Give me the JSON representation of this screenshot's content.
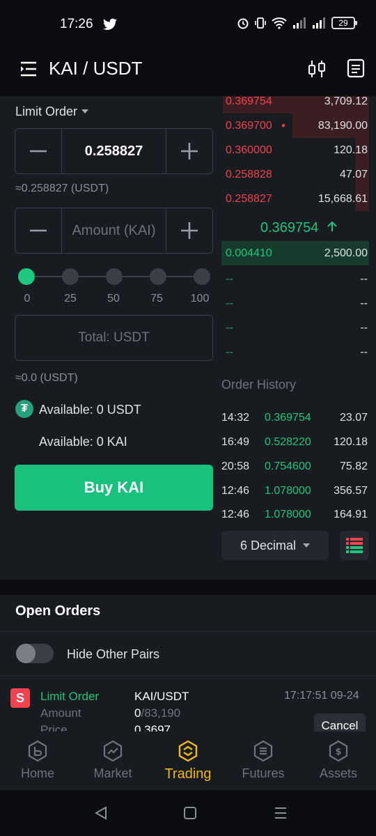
{
  "status": {
    "time": "17:26",
    "battery": "29"
  },
  "header": {
    "pair": "KAI / USDT"
  },
  "form": {
    "order_type": "Limit Order",
    "price_value": "0.258827",
    "price_approx": "≈0.258827 (USDT)",
    "amount_placeholder": "Amount (KAI)",
    "slider_labels": [
      "0",
      "25",
      "50",
      "75",
      "100"
    ],
    "slider_value_percent": 0,
    "total_placeholder": "Total: USDT",
    "total_approx": "≈0.0 (USDT)",
    "available_usdt": "Available: 0 USDT",
    "available_kai": "Available: 0 KAI",
    "buy_label": "Buy KAI"
  },
  "orderbook": {
    "asks": [
      {
        "price": "0.369754",
        "qty": "3,709.12"
      },
      {
        "price": "0.369700",
        "qty": "83,190.00",
        "mine": true
      },
      {
        "price": "0.360000",
        "qty": "120.18"
      },
      {
        "price": "0.258828",
        "qty": "47.07"
      },
      {
        "price": "0.258827",
        "qty": "15,668.61"
      }
    ],
    "last_price": "0.369754",
    "bids": [
      {
        "price": "0.004410",
        "qty": "2,500.00"
      },
      {
        "price": "--",
        "qty": "--"
      },
      {
        "price": "--",
        "qty": "--"
      },
      {
        "price": "--",
        "qty": "--"
      },
      {
        "price": "--",
        "qty": "--"
      }
    ]
  },
  "history": {
    "title": "Order History",
    "rows": [
      {
        "time": "14:32",
        "price": "0.369754",
        "qty": "23.07"
      },
      {
        "time": "16:49",
        "price": "0.528220",
        "qty": "120.18"
      },
      {
        "time": "20:58",
        "price": "0.754600",
        "qty": "75.82"
      },
      {
        "time": "12:46",
        "price": "1.078000",
        "qty": "356.57"
      },
      {
        "time": "12:46",
        "price": "1.078000",
        "qty": "164.91"
      }
    ],
    "decimal": "6 Decimal"
  },
  "open_orders": {
    "title": "Open Orders",
    "hide_label": "Hide Other Pairs",
    "order": {
      "side_badge": "S",
      "type": "Limit Order",
      "pair": "KAI/USDT",
      "time": "17:17:51 09-24",
      "amount_label": "Amount",
      "amount_filled": "0",
      "amount_total": "/83,190",
      "price_label": "Price",
      "price": "0.3697",
      "cancel_label": "Cancel"
    }
  },
  "nav": [
    {
      "label": "Home",
      "icon": "home-icon"
    },
    {
      "label": "Market",
      "icon": "market-icon"
    },
    {
      "label": "Trading",
      "icon": "trading-icon",
      "active": true
    },
    {
      "label": "Futures",
      "icon": "futures-icon"
    },
    {
      "label": "Assets",
      "icon": "assets-icon"
    }
  ],
  "colors": {
    "green": "#1fc67e",
    "red": "#f0434f",
    "accent": "#f0b90b"
  }
}
